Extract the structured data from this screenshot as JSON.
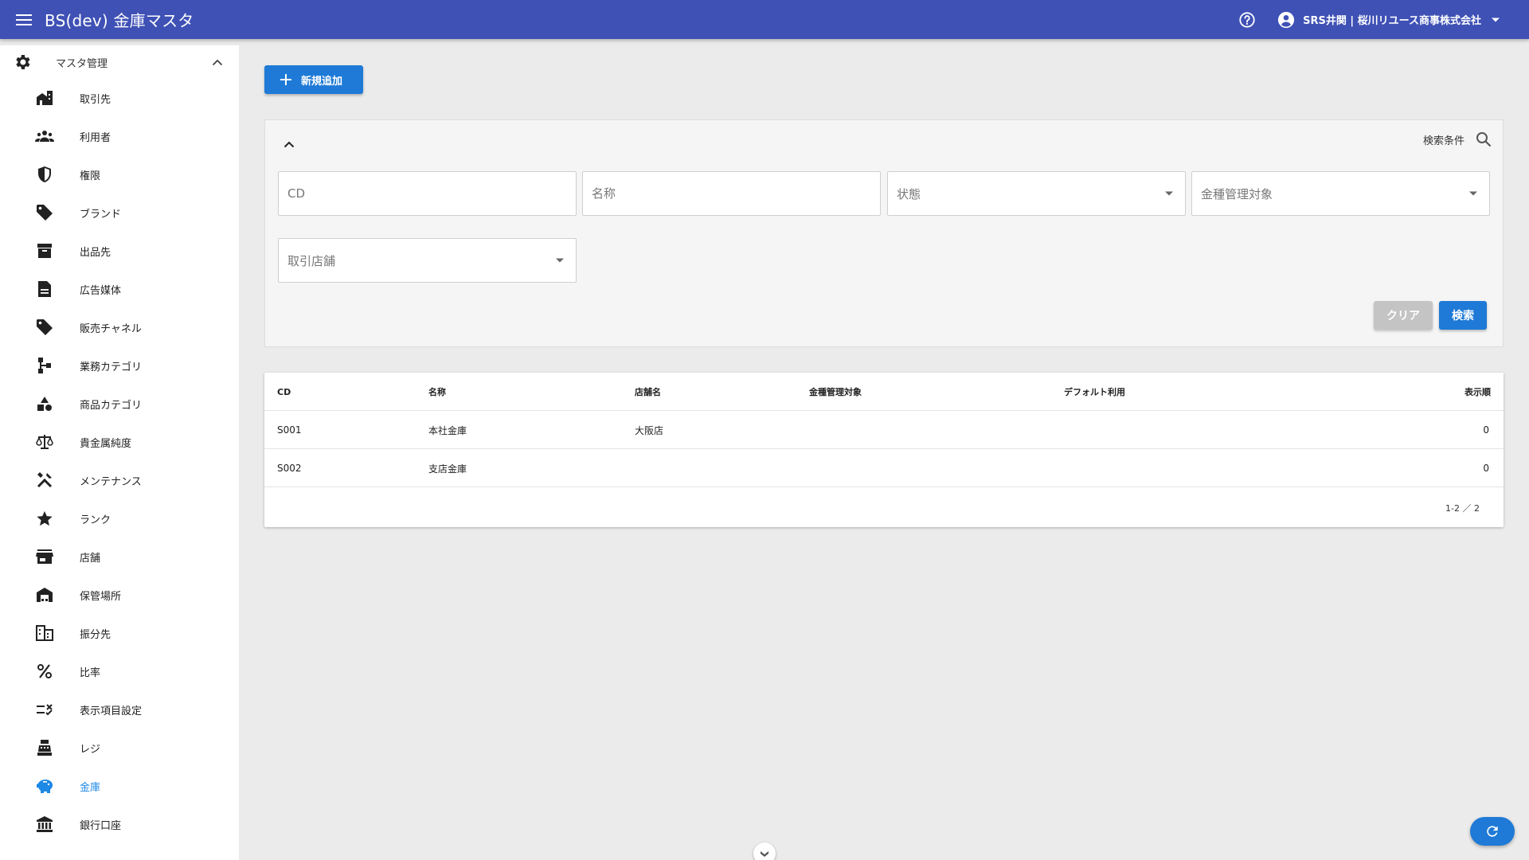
{
  "app": {
    "title": "BS(dev) 金庫マスタ",
    "user_name": "SRS井関 | 桜川リユース商事株式会社"
  },
  "sidebar": {
    "group_label": "マスタ管理",
    "items": [
      {
        "label": "取引先",
        "icon": "business-icon"
      },
      {
        "label": "利用者",
        "icon": "people-icon"
      },
      {
        "label": "権限",
        "icon": "shield-icon"
      },
      {
        "label": "ブランド",
        "icon": "tag-icon"
      },
      {
        "label": "出品先",
        "icon": "archive-icon"
      },
      {
        "label": "広告媒体",
        "icon": "document-icon"
      },
      {
        "label": "販売チャネル",
        "icon": "tag-icon"
      },
      {
        "label": "業務カテゴリ",
        "icon": "tree-icon"
      },
      {
        "label": "商品カテゴリ",
        "icon": "category-icon"
      },
      {
        "label": "貴金属純度",
        "icon": "scale-icon"
      },
      {
        "label": "メンテナンス",
        "icon": "tools-icon"
      },
      {
        "label": "ランク",
        "icon": "star-icon"
      },
      {
        "label": "店舗",
        "icon": "store-icon"
      },
      {
        "label": "保管場所",
        "icon": "warehouse-icon"
      },
      {
        "label": "振分先",
        "icon": "building-icon"
      },
      {
        "label": "比率",
        "icon": "percent-icon"
      },
      {
        "label": "表示項目設定",
        "icon": "rule-icon"
      },
      {
        "label": "レジ",
        "icon": "register-icon"
      },
      {
        "label": "金庫",
        "icon": "piggy-bank-icon"
      },
      {
        "label": "銀行口座",
        "icon": "bank-icon"
      }
    ],
    "active_label": "金庫"
  },
  "toolbar": {
    "add_label": "新規追加"
  },
  "search": {
    "title": "検索条件",
    "cd_placeholder": "CD",
    "name_placeholder": "名称",
    "status_placeholder": "状態",
    "money_placeholder": "金種管理対象",
    "store_placeholder": "取引店舗",
    "clear_label": "クリア",
    "search_label": "検索"
  },
  "table": {
    "columns": [
      "CD",
      "名称",
      "店舗名",
      "金種管理対象",
      "デフォルト利用",
      "表示順"
    ],
    "rows": [
      [
        "S001",
        "本社金庫",
        "大阪店",
        "",
        "",
        "0"
      ],
      [
        "S002",
        "支店金庫",
        "",
        "",
        "",
        "0"
      ]
    ],
    "pagination": "1-2 ／ 2"
  },
  "colors": {
    "primary": "#3f51b5",
    "accent": "#1e7ad6",
    "active_nav": "#1e88e5"
  }
}
